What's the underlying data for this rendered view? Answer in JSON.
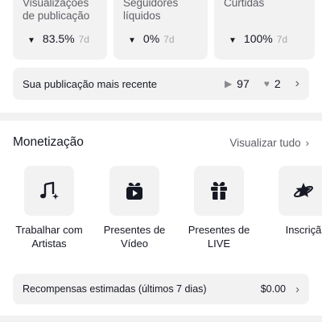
{
  "stats": [
    {
      "label_line1": "Visualizações",
      "label_line2": "de publicação",
      "value": "83.5%",
      "period": "7d",
      "trend_icon": "triangle-down-icon"
    },
    {
      "label_line1": "Seguidores",
      "label_line2": "líquidos",
      "value": "0%",
      "period": "7d",
      "trend_icon": "triangle-down-icon"
    },
    {
      "label_line1": "Curtidas",
      "label_line2": "",
      "value": "100%",
      "period": "7d",
      "trend_icon": "triangle-down-icon"
    }
  ],
  "recent_post": {
    "label": "Sua publicação mais recente",
    "views": "97",
    "likes": "2"
  },
  "monetization": {
    "title": "Monetização",
    "view_all": "Visualizar tudo",
    "tiles": [
      {
        "line1": "Trabalhar com",
        "line2": "Artistas",
        "icon": "music-sparkle-icon"
      },
      {
        "line1": "Presentes de",
        "line2": "Vídeo",
        "icon": "gift-video-icon"
      },
      {
        "line1": "Presentes de",
        "line2": "LIVE",
        "icon": "gift-icon"
      },
      {
        "line1": "Inscriçã",
        "line2": "",
        "icon": "star-planet-icon"
      }
    ],
    "rewards": {
      "label": "Recompensas estimadas (últimos 7 dias)",
      "value": "$0.00"
    }
  },
  "colors": {
    "background": "#f2f2f2",
    "card": "#ffffff",
    "text": "#161823",
    "muted": "#a8a8ad"
  }
}
